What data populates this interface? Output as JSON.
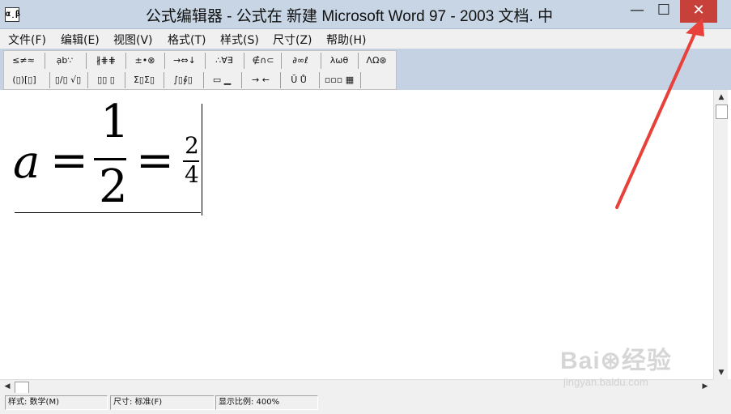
{
  "window": {
    "app_icon": "α̣β",
    "title": "公式编辑器 - 公式在 新建 Microsoft Word 97 - 2003 文档. 中",
    "minimize_icon": "minimize-icon",
    "minimize_glyph": "—",
    "maximize_icon": "maximize-icon",
    "maximize_glyph": "☐",
    "close_icon": "close-icon",
    "close_glyph": "✕",
    "close_color": "#c7403a",
    "titlebar_color": "#c7d5e4"
  },
  "menu": {
    "items": [
      "文件(F)",
      "编辑(E)",
      "视图(V)",
      "格式(T)",
      "样式(S)",
      "尺寸(Z)",
      "帮助(H)"
    ]
  },
  "palette": {
    "row1": [
      "≤≠≈",
      "ạb∵",
      "∦⋕⋕",
      "±•⊗",
      "→⇔↓",
      "∴∀∃",
      "∉∩⊂",
      "∂∞ℓ",
      "λωθ",
      "ΛΩ⊛"
    ],
    "row2": [
      "(▯)[▯]",
      "▯/▯ √▯",
      "▯▯ ▯",
      "Σ▯Σ▯",
      "∫▯∮▯",
      "▭ ▁",
      "→ ←",
      "Ū Ů",
      "▫▫▫ ▦"
    ]
  },
  "equation": {
    "lhs": "a",
    "equals": "=",
    "frac1_num": "1",
    "frac1_den": "2",
    "frac2_num": "2",
    "frac2_den": "4"
  },
  "scrollbars": {
    "up_arrow": "▲",
    "down_arrow": "▼",
    "left_arrow": "◀",
    "right_arrow": "▶"
  },
  "status": {
    "style": "样式: 数学(M)",
    "size": "尺寸: 标准(F)",
    "zoom": "显示比例: 400%"
  },
  "watermark": {
    "logo": "Bai⊛经验",
    "url": "jingyan.baidu.com"
  },
  "annotation": {
    "arrow_color": "#e8403a"
  }
}
